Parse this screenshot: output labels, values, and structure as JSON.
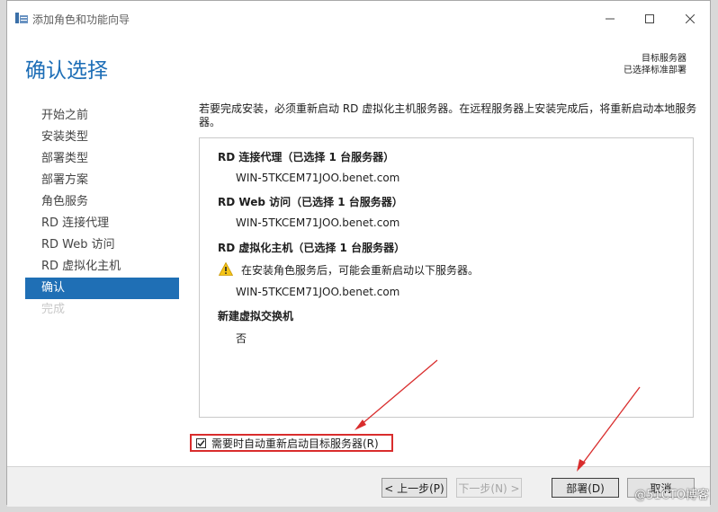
{
  "window": {
    "title": "添加角色和功能向导",
    "controls": {
      "minimize": "minimize",
      "maximize": "maximize",
      "close": "close"
    }
  },
  "header": {
    "page_title": "确认选择",
    "target_label": "目标服务器",
    "target_value": "已选择标准部署"
  },
  "nav": {
    "items": [
      {
        "label": "开始之前",
        "state": "normal"
      },
      {
        "label": "安装类型",
        "state": "normal"
      },
      {
        "label": "部署类型",
        "state": "normal"
      },
      {
        "label": "部署方案",
        "state": "normal"
      },
      {
        "label": "角色服务",
        "state": "normal"
      },
      {
        "label": "RD 连接代理",
        "state": "normal"
      },
      {
        "label": "RD Web 访问",
        "state": "normal"
      },
      {
        "label": "RD 虚拟化主机",
        "state": "normal"
      },
      {
        "label": "确认",
        "state": "active"
      },
      {
        "label": "完成",
        "state": "disabled"
      }
    ]
  },
  "main": {
    "description": "若要完成安装，必须重新启动 RD 虚拟化主机服务器。在远程服务器上安装完成后，将重新启动本地服务器。",
    "sections": [
      {
        "heading": "RD 连接代理（已选择 1 台服务器）",
        "value": "WIN-5TKCEM71JOO.benet.com"
      },
      {
        "heading": "RD Web 访问（已选择 1 台服务器）",
        "value": "WIN-5TKCEM71JOO.benet.com"
      },
      {
        "heading": "RD 虚拟化主机（已选择 1 台服务器）",
        "warning": "在安装角色服务后，可能会重新启动以下服务器。",
        "value": "WIN-5TKCEM71JOO.benet.com"
      },
      {
        "heading": "新建虚拟交换机",
        "value": "否"
      }
    ],
    "restart_checkbox": {
      "label": "需要时自动重新启动目标服务器(R)",
      "checked": true
    }
  },
  "footer": {
    "prev": "< 上一步(P)",
    "next": "下一步(N) >",
    "deploy": "部署(D)",
    "cancel": "取消"
  },
  "watermark": "@51CTO博客",
  "colors": {
    "accent": "#1f6fb5",
    "title": "#1c6db6",
    "annotation": "#d92d2d"
  }
}
